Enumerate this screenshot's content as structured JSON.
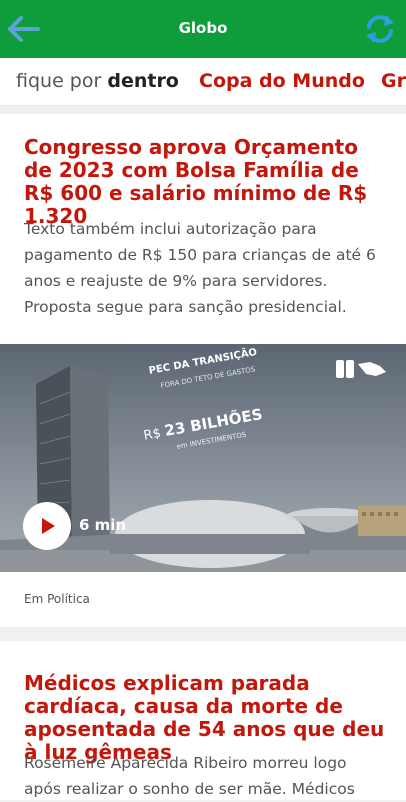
{
  "appbar": {
    "title": "Globo",
    "back_icon": "arrow-left-icon",
    "refresh_icon": "refresh-icon",
    "colors": {
      "background": "#0f9d3c",
      "icon_blue": "#5aa3d6",
      "refresh_blue": "#2aa0e0"
    }
  },
  "tabs": {
    "fique_light": "fique por",
    "fique_bold": "dentro",
    "copa": "Copa do Mundo",
    "partial": "Gr"
  },
  "feed": [
    {
      "headline": "Congresso aprova Orçamento de 2023 com Bolsa Família de R$ 600 e salário mínimo de R$ 1.320",
      "summary": "Texto também inclui autorização para pagamento de R$ 150 para crianças de até 6 anos e reajuste de 9% para servidores. Proposta segue para sanção presidencial.",
      "video": {
        "duration": "6 min",
        "overlay_line1": "PEC DA TRANSIÇÃO",
        "overlay_line2": "FORA DO TETO DE GASTOS",
        "overlay_amount_prefix": "R$",
        "overlay_amount": "23 BILHÕES",
        "overlay_line4": "em INVESTIMENTOS"
      },
      "section": "Em Política"
    },
    {
      "headline": "Médicos explicam parada cardíaca, causa da morte de aposentada de 54 anos que deu à luz gêmeas",
      "summary": "Rosemeire Aparecida Ribeiro morreu logo após realizar o sonho de ser mãe. Médicos"
    }
  ],
  "colors": {
    "accent": "#c4170c"
  }
}
